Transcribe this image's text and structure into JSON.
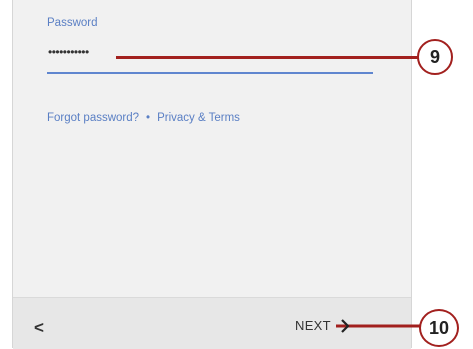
{
  "form": {
    "password_label": "Password",
    "password_value": "•••••••••••",
    "forgot_password": "Forgot password?",
    "separator": "•",
    "privacy_terms": "Privacy & Terms"
  },
  "nav": {
    "back_icon": "chevron-left-icon",
    "back_glyph": "<",
    "next_label": "NEXT"
  },
  "callouts": [
    {
      "number": "9"
    },
    {
      "number": "10"
    }
  ],
  "colors": {
    "accent": "#5f86cf",
    "callout": "#a2201e"
  }
}
